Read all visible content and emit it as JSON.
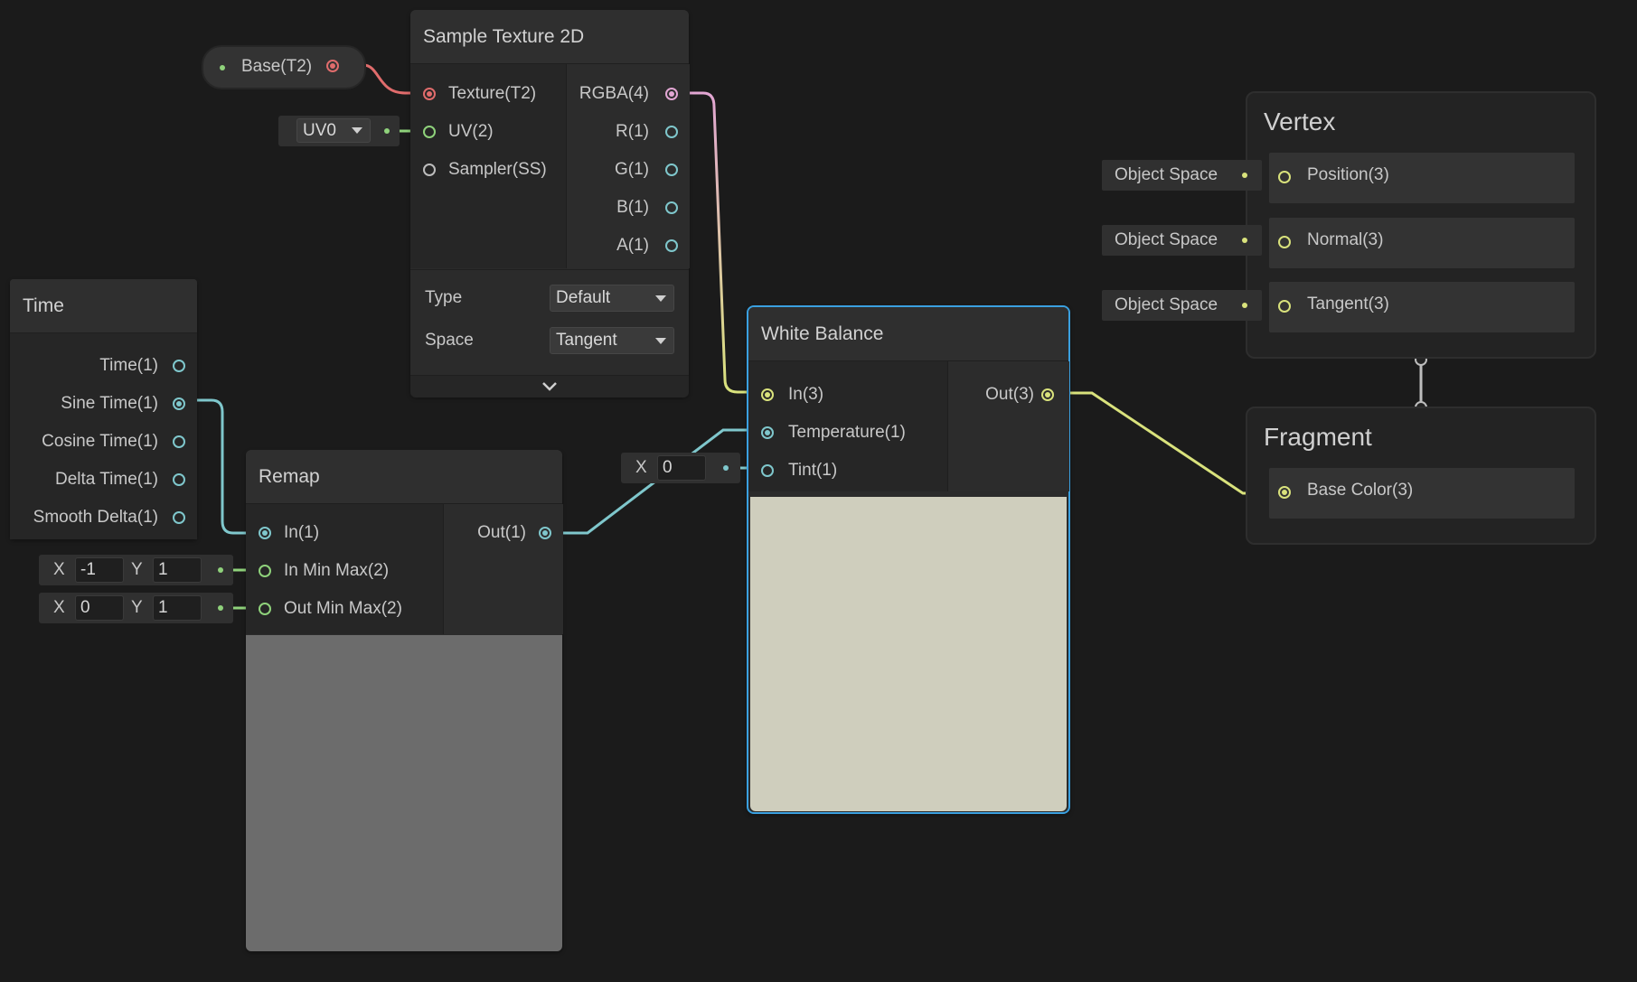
{
  "property_node": {
    "label": "Base(T2)"
  },
  "sample_texture": {
    "title": "Sample Texture 2D",
    "inputs": [
      "Texture(T2)",
      "UV(2)",
      "Sampler(SS)"
    ],
    "outputs": [
      "RGBA(4)",
      "R(1)",
      "G(1)",
      "B(1)",
      "A(1)"
    ],
    "type_label": "Type",
    "type_value": "Default",
    "space_label": "Space",
    "space_value": "Tangent",
    "uv_value": "UV0"
  },
  "time_node": {
    "title": "Time",
    "outputs": [
      "Time(1)",
      "Sine Time(1)",
      "Cosine Time(1)",
      "Delta Time(1)",
      "Smooth Delta(1)"
    ]
  },
  "remap": {
    "title": "Remap",
    "inputs": [
      "In(1)",
      "In Min Max(2)",
      "Out Min Max(2)"
    ],
    "output": "Out(1)",
    "in_min_max": {
      "x_label": "X",
      "x": "-1",
      "y_label": "Y",
      "y": "1"
    },
    "out_min_max": {
      "x_label": "X",
      "x": "0",
      "y_label": "Y",
      "y": "1"
    }
  },
  "white_balance": {
    "title": "White Balance",
    "inputs": [
      "In(3)",
      "Temperature(1)",
      "Tint(1)"
    ],
    "output": "Out(3)",
    "tint_x_label": "X",
    "tint_x": "0",
    "preview_color": "#cfcebd"
  },
  "vertex": {
    "title": "Vertex",
    "blocks": [
      "Position(3)",
      "Normal(3)",
      "Tangent(3)"
    ],
    "space_fields": [
      "Object Space",
      "Object Space",
      "Object Space"
    ]
  },
  "fragment": {
    "title": "Fragment",
    "blocks": [
      "Base Color(3)"
    ]
  },
  "colors": {
    "background": "#1b1b1b",
    "selection": "#3aa0e0",
    "texture_wire": "#e06c6c",
    "vector2_wire": "#8fd27b",
    "float_wire": "#7fc7cc",
    "vector3_wire": "#d9e27c",
    "vector4_wire": "#e2a6d3"
  }
}
